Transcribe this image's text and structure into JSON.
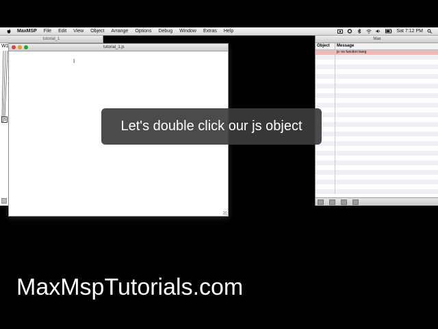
{
  "menubar": {
    "app": "MaxMSP",
    "items": [
      "File",
      "Edit",
      "View",
      "Object",
      "Arrange",
      "Options",
      "Debug",
      "Window",
      "Extras",
      "Help"
    ],
    "clock": "Sat 7:12 PM"
  },
  "patcher_window": {
    "title": "tutorial_1",
    "label": "W1",
    "js_object": "js"
  },
  "editor_window": {
    "title": "tutorial_1.js"
  },
  "max_window": {
    "title": "Max",
    "col_object": "Object",
    "col_message": "Message",
    "rows": [
      {
        "object": "",
        "message": "js: no function bang"
      }
    ]
  },
  "caption": "Let's double click our js object",
  "brand": "MaxMspTutorials.com",
  "colors": {
    "error_row": "#f2b8b8",
    "close": "#e0443e",
    "min": "#dea123",
    "max": "#1aab29"
  }
}
